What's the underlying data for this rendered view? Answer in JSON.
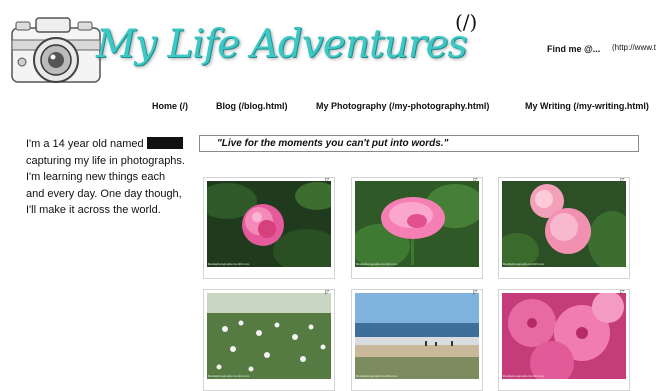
{
  "site": {
    "title": "My Life Adventures",
    "home_link": "(/)"
  },
  "find_me": {
    "label": "Find me @...",
    "link_text": "(http://www.tumblr.com)"
  },
  "nav": [
    {
      "label": "Home (/)"
    },
    {
      "label": "Blog (/blog.html)"
    },
    {
      "label": "My Photography (/my-photography.html)"
    },
    {
      "label": "My Writing (/my-writing.html)"
    }
  ],
  "bio": {
    "before": "I'm a 14 year old named",
    "after": "capturing my life in photographs. I'm learning new things each and every day. One day though, I'll make it across the world."
  },
  "quote": "\"Live for the moments you can't put into words.\"",
  "gallery": [
    {
      "caption": "lifeofaphotographer.tumblr.com"
    },
    {
      "caption": "lifeofaphotographer.tumblr.com"
    },
    {
      "caption": "lifeofaphotographer.tumblr.com"
    },
    {
      "caption": "lifeofaphotographer.tumblr.com"
    },
    {
      "caption": "lifeofaphotographer.tumblr.com"
    },
    {
      "caption": "lifeofaphotographer.tumblr.com"
    }
  ],
  "colors": {
    "logo": "#3cc9c6",
    "text": "#111111"
  },
  "icons": {
    "camera": "vintage-camera-sketch-icon",
    "tile_corner": "corner-mark-icon"
  }
}
